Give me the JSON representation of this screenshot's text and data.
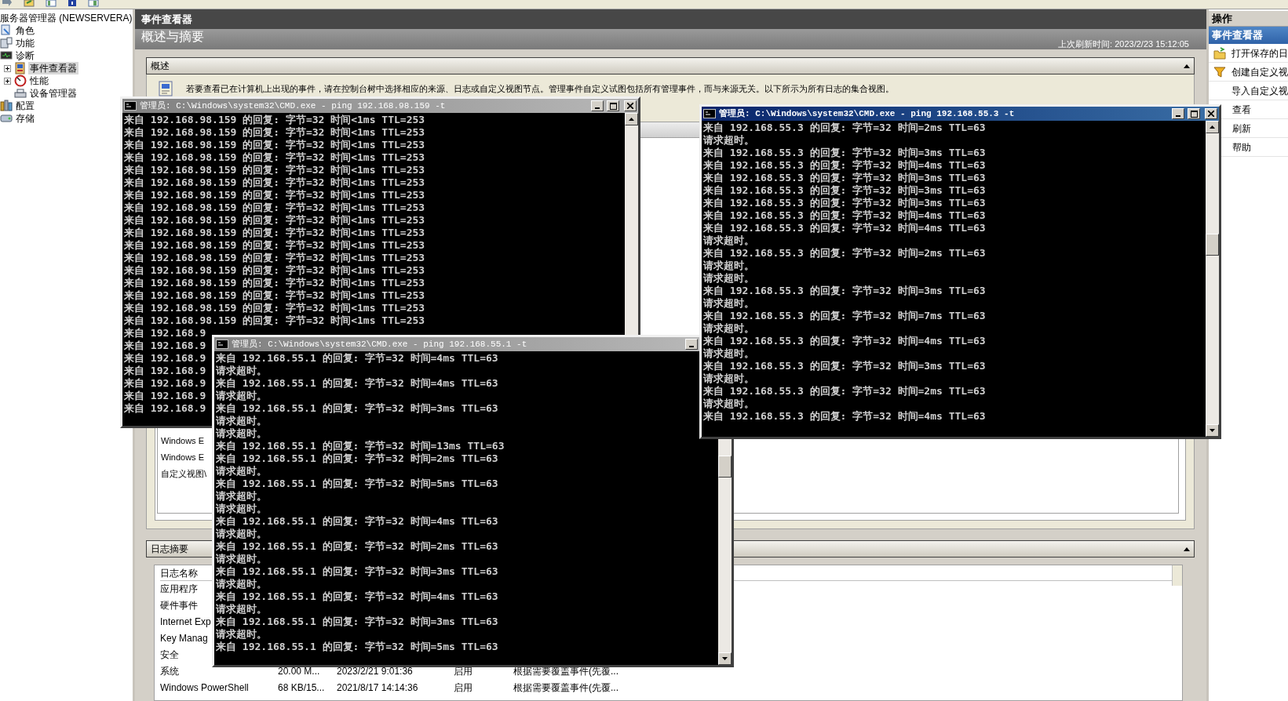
{
  "tree": {
    "label": "服务器管理器 (NEWSERVERA)",
    "children": [
      {
        "label": "角色",
        "selected": false
      },
      {
        "label": "功能",
        "selected": false
      },
      {
        "label": "诊断",
        "selected": false,
        "children": [
          {
            "label": "事件查看器",
            "selected": true,
            "expanded": false
          },
          {
            "label": "性能",
            "selected": false,
            "expanded": false
          },
          {
            "label": "设备管理器",
            "selected": false
          }
        ]
      },
      {
        "label": "配置",
        "selected": false
      },
      {
        "label": "存储",
        "selected": false
      }
    ]
  },
  "main": {
    "title": "事件查看器",
    "subtitle": "概述与摘要",
    "refresh_time": "上次刷新时间: 2023/2/23 15:12:05",
    "overview": {
      "title": "概述",
      "description": "若要查看已在计算机上出现的事件，请在控制台树中选择相应的来源、日志或自定义视图节点。管理事件自定义试图包括所有管理事件，而与来源无关。以下所示为所有日志的集合视图。",
      "list": [
        "Windows E",
        "Windows E",
        "自定义视图\\"
      ]
    },
    "log_summary": {
      "title": "日志摘要",
      "columns": [
        "日志名称"
      ],
      "rows": [
        [
          "应用程序"
        ],
        [
          "硬件事件"
        ],
        [
          "Internet Exp"
        ],
        [
          "Key Manag"
        ],
        [
          "安全"
        ],
        [
          "系统",
          "20.00 M...",
          "2023/2/21 9:01:36",
          "启用",
          "根据需要覆盖事件(先覆..."
        ],
        [
          "Windows PowerShell",
          "68 KB/15...",
          "2021/8/17 14:14:36",
          "启用",
          "根据需要覆盖事件(先覆..."
        ]
      ]
    }
  },
  "actions": {
    "title": "操作",
    "section": "事件查看器",
    "items": [
      "打开保存的日",
      "创建自定义视",
      "导入自定义视",
      "查看",
      "刷新",
      "帮助"
    ]
  },
  "windows": [
    {
      "title": "管理员: C:\\Windows\\system32\\CMD.exe - ping 192.168.98.159 -t",
      "active": false,
      "lines": [
        "来自 192.168.98.159 的回复: 字节=32 时间<1ms TTL=253",
        "来自 192.168.98.159 的回复: 字节=32 时间<1ms TTL=253",
        "来自 192.168.98.159 的回复: 字节=32 时间<1ms TTL=253",
        "来自 192.168.98.159 的回复: 字节=32 时间<1ms TTL=253",
        "来自 192.168.98.159 的回复: 字节=32 时间<1ms TTL=253",
        "来自 192.168.98.159 的回复: 字节=32 时间<1ms TTL=253",
        "来自 192.168.98.159 的回复: 字节=32 时间<1ms TTL=253",
        "来自 192.168.98.159 的回复: 字节=32 时间<1ms TTL=253",
        "来自 192.168.98.159 的回复: 字节=32 时间<1ms TTL=253",
        "来自 192.168.98.159 的回复: 字节=32 时间<1ms TTL=253",
        "来自 192.168.98.159 的回复: 字节=32 时间<1ms TTL=253",
        "来自 192.168.98.159 的回复: 字节=32 时间<1ms TTL=253",
        "来自 192.168.98.159 的回复: 字节=32 时间<1ms TTL=253",
        "来自 192.168.98.159 的回复: 字节=32 时间<1ms TTL=253",
        "来自 192.168.98.159 的回复: 字节=32 时间<1ms TTL=253",
        "来自 192.168.98.159 的回复: 字节=32 时间<1ms TTL=253",
        "来自 192.168.98.159 的回复: 字节=32 时间<1ms TTL=253",
        "来自 192.168.9",
        "来自 192.168.9",
        "来自 192.168.9",
        "来自 192.168.9",
        "来自 192.168.9",
        "来自 192.168.9",
        "来自 192.168.9"
      ]
    },
    {
      "title": "管理员: C:\\Windows\\system32\\CMD.exe - ping 192.168.55.1 -t",
      "active": false,
      "lines": [
        "来自 192.168.55.1 的回复: 字节=32 时间=4ms TTL=63",
        "请求超时。",
        "来自 192.168.55.1 的回复: 字节=32 时间=4ms TTL=63",
        "请求超时。",
        "来自 192.168.55.1 的回复: 字节=32 时间=3ms TTL=63",
        "请求超时。",
        "请求超时。",
        "来自 192.168.55.1 的回复: 字节=32 时间=13ms TTL=63",
        "来自 192.168.55.1 的回复: 字节=32 时间=2ms TTL=63",
        "请求超时。",
        "来自 192.168.55.1 的回复: 字节=32 时间=5ms TTL=63",
        "请求超时。",
        "请求超时。",
        "来自 192.168.55.1 的回复: 字节=32 时间=4ms TTL=63",
        "请求超时。",
        "来自 192.168.55.1 的回复: 字节=32 时间=2ms TTL=63",
        "请求超时。",
        "来自 192.168.55.1 的回复: 字节=32 时间=3ms TTL=63",
        "请求超时。",
        "来自 192.168.55.1 的回复: 字节=32 时间=4ms TTL=63",
        "请求超时。",
        "来自 192.168.55.1 的回复: 字节=32 时间=3ms TTL=63",
        "请求超时。",
        "来自 192.168.55.1 的回复: 字节=32 时间=5ms TTL=63"
      ]
    },
    {
      "title": "管理员: C:\\Windows\\system32\\CMD.exe - ping 192.168.55.3 -t",
      "active": true,
      "lines": [
        "来自 192.168.55.3 的回复: 字节=32 时间=2ms TTL=63",
        "请求超时。",
        "来自 192.168.55.3 的回复: 字节=32 时间=3ms TTL=63",
        "来自 192.168.55.3 的回复: 字节=32 时间=4ms TTL=63",
        "来自 192.168.55.3 的回复: 字节=32 时间=3ms TTL=63",
        "来自 192.168.55.3 的回复: 字节=32 时间=3ms TTL=63",
        "来自 192.168.55.3 的回复: 字节=32 时间=3ms TTL=63",
        "来自 192.168.55.3 的回复: 字节=32 时间=4ms TTL=63",
        "来自 192.168.55.3 的回复: 字节=32 时间=4ms TTL=63",
        "请求超时。",
        "来自 192.168.55.3 的回复: 字节=32 时间=2ms TTL=63",
        "请求超时。",
        "请求超时。",
        "来自 192.168.55.3 的回复: 字节=32 时间=3ms TTL=63",
        "请求超时。",
        "来自 192.168.55.3 的回复: 字节=32 时间=7ms TTL=63",
        "请求超时。",
        "来自 192.168.55.3 的回复: 字节=32 时间=4ms TTL=63",
        "请求超时。",
        "来自 192.168.55.3 的回复: 字节=32 时间=3ms TTL=63",
        "请求超时。",
        "来自 192.168.55.3 的回复: 字节=32 时间=2ms TTL=63",
        "请求超时。",
        "来自 192.168.55.3 的回复: 字节=32 时间=4ms TTL=63"
      ]
    }
  ]
}
